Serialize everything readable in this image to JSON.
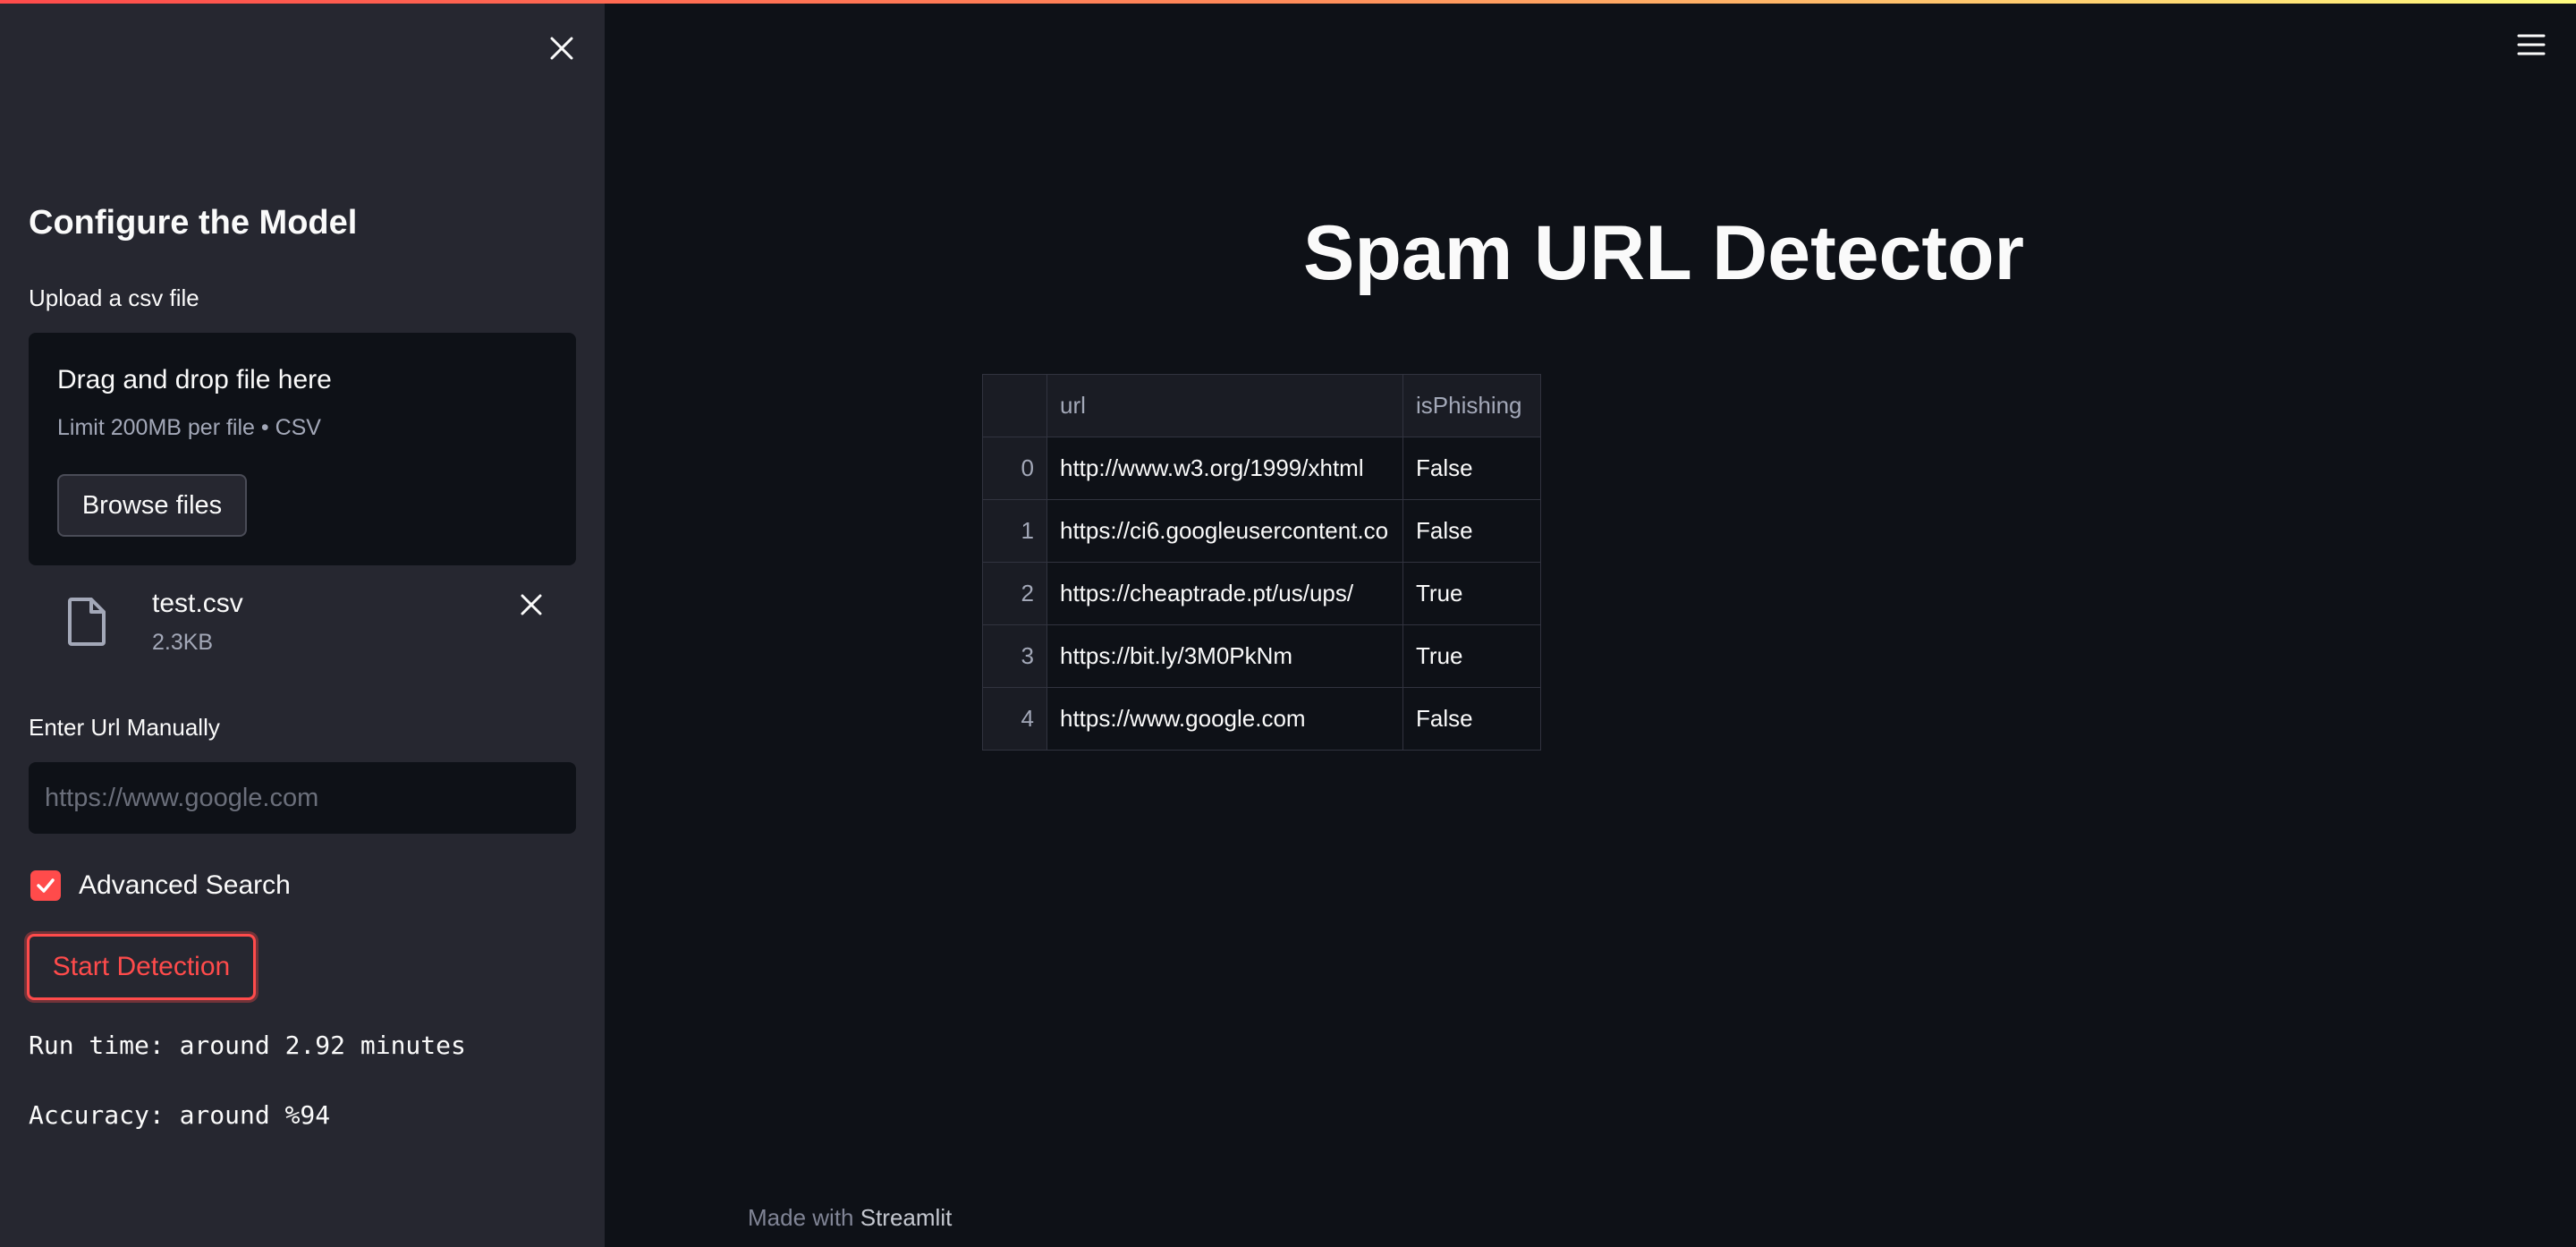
{
  "sidebar": {
    "title": "Configure the Model",
    "upload_label": "Upload a csv file",
    "dropzone": {
      "title": "Drag and drop file here",
      "limit": "Limit 200MB per file • CSV",
      "browse_label": "Browse files"
    },
    "file": {
      "name": "test.csv",
      "size": "2.3KB"
    },
    "manual_label": "Enter Url Manually",
    "url_placeholder": "https://www.google.com",
    "advanced_search_label": "Advanced Search",
    "advanced_search_checked": true,
    "detect_label": "Start Detection",
    "run_time": "Run time: around 2.92 minutes",
    "accuracy": "Accuracy: around %94"
  },
  "main": {
    "title": "Spam URL Detector",
    "table": {
      "columns": [
        "",
        "url",
        "isPhishing"
      ],
      "rows": [
        {
          "index": "0",
          "url": "http://www.w3.org/1999/xhtml",
          "isPhishing": "False"
        },
        {
          "index": "1",
          "url": "https://ci6.googleusercontent.co",
          "isPhishing": "False"
        },
        {
          "index": "2",
          "url": "https://cheaptrade.pt/us/ups/",
          "isPhishing": "True"
        },
        {
          "index": "3",
          "url": "https://bit.ly/3M0PkNm",
          "isPhishing": "True"
        },
        {
          "index": "4",
          "url": "https://www.google.com",
          "isPhishing": "False"
        }
      ]
    }
  },
  "footer": {
    "prefix": "Made with ",
    "brand": "Streamlit"
  },
  "colors": {
    "background": "#0e1117",
    "sidebar": "#262730",
    "accent": "#ff4b4b"
  },
  "icons": [
    "close-icon",
    "file-icon",
    "check-icon",
    "hamburger-menu-icon"
  ]
}
